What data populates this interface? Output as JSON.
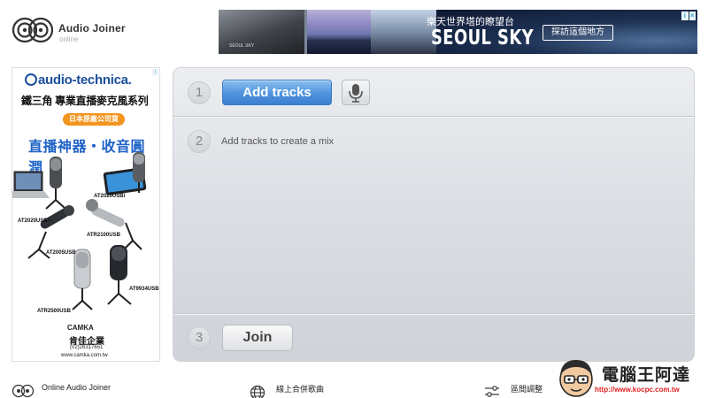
{
  "header": {
    "app_title": "Audio Joiner",
    "status": "online"
  },
  "top_banner": {
    "headline": "樂天世界塔的瞭望台",
    "brand": "SEOUL SKY",
    "cta": "探訪這個地方",
    "photo_caption": "SEOUL SKY"
  },
  "left_ad": {
    "brand": "audio-technica.",
    "title": "鐵三角 專業直播麥克風系列",
    "badge": "日本原廠公司貨",
    "slogan": "直播神器・收音圓潤",
    "models": [
      "AT2020USBi",
      "AT2020USB+",
      "ATR2100USB",
      "AT2005USB",
      "AT9934USB",
      "ATR2500USB"
    ],
    "distributor_logo": "CAMKA",
    "distributor": "肯佳企業",
    "phone": "(02)26317651",
    "url": "www.camka.com.tw"
  },
  "main": {
    "steps": [
      {
        "number": "1"
      },
      {
        "number": "2"
      },
      {
        "number": "3"
      }
    ],
    "add_tracks_label": "Add tracks",
    "hint": "Add tracks to create a mix",
    "join_label": "Join"
  },
  "footer": {
    "items": [
      {
        "label": "Online Audio Joiner",
        "icon": "app-logo-icon"
      },
      {
        "label": "線上合併歌曲",
        "icon": "globe-icon"
      },
      {
        "label": "區間調整",
        "icon": "equalizer-icon"
      }
    ]
  },
  "watermark": {
    "name": "電腦王阿達",
    "url": "http://www.kocpc.com.tw"
  },
  "colors": {
    "accent_blue": "#4f92dd",
    "panel_bg": "#dcdfe4",
    "ad_orange": "#f3941e",
    "ad_blue": "#1f63c7"
  }
}
